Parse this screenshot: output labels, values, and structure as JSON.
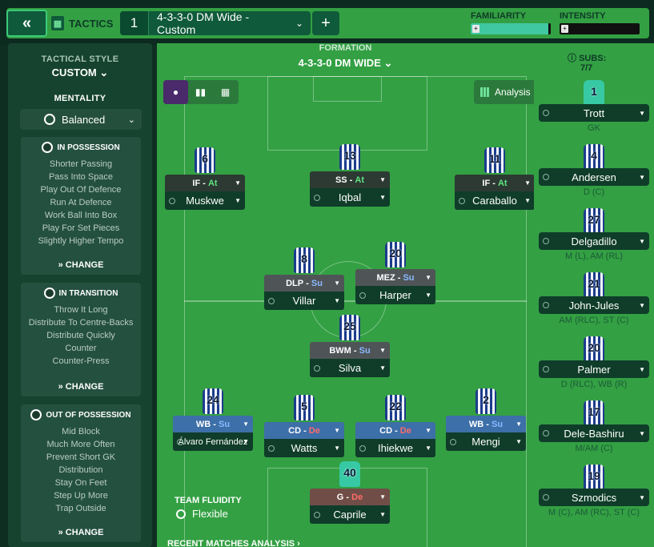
{
  "topbar": {
    "back_label": "«",
    "tactics_label": "TACTICS",
    "tactic_number": "1",
    "tactic_name": "4-3-3-0 DM Wide - Custom",
    "add_label": "+",
    "familiarity_label": "FAMILIARITY",
    "intensity_label": "INTENSITY",
    "familiarity_level": 0.97,
    "intensity_level": 0.0
  },
  "left": {
    "style_label": "TACTICAL STYLE",
    "style_value": "CUSTOM",
    "mentality_label": "MENTALITY",
    "mentality_value": "Balanced",
    "in_possession": {
      "title": "IN POSSESSION",
      "items": [
        "Shorter Passing",
        "Pass Into Space",
        "Play Out Of Defence",
        "Run At Defence",
        "Work Ball Into Box",
        "Play For Set Pieces",
        "Slightly Higher Tempo"
      ],
      "change": "CHANGE"
    },
    "in_transition": {
      "title": "IN TRANSITION",
      "items": [
        "Throw It Long",
        "Distribute To Centre-Backs",
        "Distribute Quickly",
        "Counter",
        "Counter-Press"
      ],
      "change": "CHANGE"
    },
    "out_possession": {
      "title": "OUT OF POSSESSION",
      "items": [
        "Mid Block",
        "Much More Often",
        "Prevent Short GK",
        "Distribution",
        "Stay On Feet",
        "Step Up More",
        "Trap Outside"
      ],
      "change": "CHANGE"
    }
  },
  "pitch": {
    "formation_label": "FORMATION",
    "formation_name": "4-3-3-0 DM WIDE",
    "analysis_label": "Analysis",
    "fluidity_label": "TEAM FLUIDITY",
    "fluidity_value": "Flexible",
    "recent_label": "RECENT MATCHES ANALYSIS"
  },
  "players": [
    {
      "num": "6",
      "role": "IF",
      "duty": "At",
      "name": "Muskwe",
      "style": ""
    },
    {
      "num": "13",
      "role": "SS",
      "duty": "At",
      "name": "Iqbal",
      "style": ""
    },
    {
      "num": "11",
      "role": "IF",
      "duty": "At",
      "name": "Caraballo",
      "style": ""
    },
    {
      "num": "8",
      "role": "DLP",
      "duty": "Su",
      "name": "Villar",
      "style": "gray"
    },
    {
      "num": "20",
      "role": "MEZ",
      "duty": "Su",
      "name": "Harper",
      "style": "gray"
    },
    {
      "num": "25",
      "role": "BWM",
      "duty": "Su",
      "name": "Silva",
      "style": "gray"
    },
    {
      "num": "24",
      "role": "WB",
      "duty": "Su",
      "name": "Álvaro Fernández",
      "style": "blue"
    },
    {
      "num": "5",
      "role": "CD",
      "duty": "De",
      "name": "Watts",
      "style": "blue"
    },
    {
      "num": "22",
      "role": "CD",
      "duty": "De",
      "name": "Ihiekwe",
      "style": "blue"
    },
    {
      "num": "2",
      "role": "WB",
      "duty": "Su",
      "name": "Mengi",
      "style": "blue"
    },
    {
      "num": "40",
      "role": "G",
      "duty": "De",
      "name": "Caprile",
      "style": "brown"
    }
  ],
  "subs": {
    "label": "SUBS:",
    "count": "7/7",
    "list": [
      {
        "num": "1",
        "name": "Trott",
        "pos": "GK"
      },
      {
        "num": "4",
        "name": "Andersen",
        "pos": "D (C)"
      },
      {
        "num": "27",
        "name": "Delgadillo",
        "pos": "M (L), AM (RL)"
      },
      {
        "num": "21",
        "name": "John-Jules",
        "pos": "AM (RLC), ST (C)"
      },
      {
        "num": "20",
        "name": "Palmer",
        "pos": "D (RLC), WB (R)"
      },
      {
        "num": "17",
        "name": "Dele-Bashiru",
        "pos": "M/AM (C)"
      },
      {
        "num": "19",
        "name": "Szmodics",
        "pos": "M (C), AM (RC), ST (C)"
      }
    ]
  },
  "colors": {
    "pitch": "#33a043",
    "panel": "#16432f",
    "attack_duty": "#5fe37f",
    "support_duty": "#8ab8ff",
    "defend_duty": "#ff6b6b",
    "familiarity_fill": "#40c8a0"
  }
}
